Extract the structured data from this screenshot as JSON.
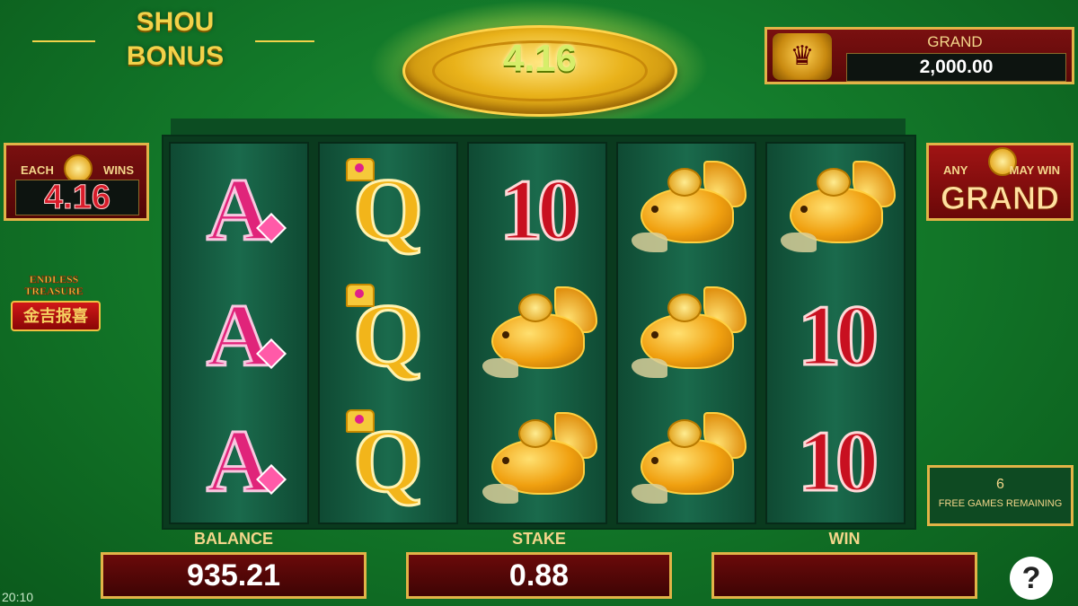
{
  "bonus": {
    "line1": "SHOU",
    "line2": "BONUS"
  },
  "coin": {
    "value": "4.16"
  },
  "jackpot": {
    "label": "GRAND",
    "value": "2,000.00"
  },
  "each_panel": {
    "each": "EACH",
    "wins": "WINS",
    "value": "4.16"
  },
  "grand_panel": {
    "any": "ANY",
    "may_win": "MAY WIN",
    "grand": "GRAND"
  },
  "logo": {
    "line1": "ENDLESS",
    "line2": "TREASURE",
    "chinese": "金吉报喜"
  },
  "reels": [
    [
      "A",
      "A",
      "A"
    ],
    [
      "Q",
      "Q",
      "Q"
    ],
    [
      "10",
      "fish",
      "fish"
    ],
    [
      "fish",
      "fish",
      "fish"
    ],
    [
      "fish",
      "10",
      "10"
    ]
  ],
  "free_games": {
    "count": "6",
    "label": "FREE GAMES REMAINING"
  },
  "bottom": {
    "balance_label": "BALANCE",
    "balance_value": "935.21",
    "stake_label": "STAKE",
    "stake_value": "0.88",
    "win_label": "WIN",
    "win_value": ""
  },
  "help": {
    "label": "?"
  },
  "clock": "20:10",
  "colors": {
    "gold": "#e2b347",
    "panel_red": "#7a1010",
    "felt_green": "#137a2a"
  }
}
